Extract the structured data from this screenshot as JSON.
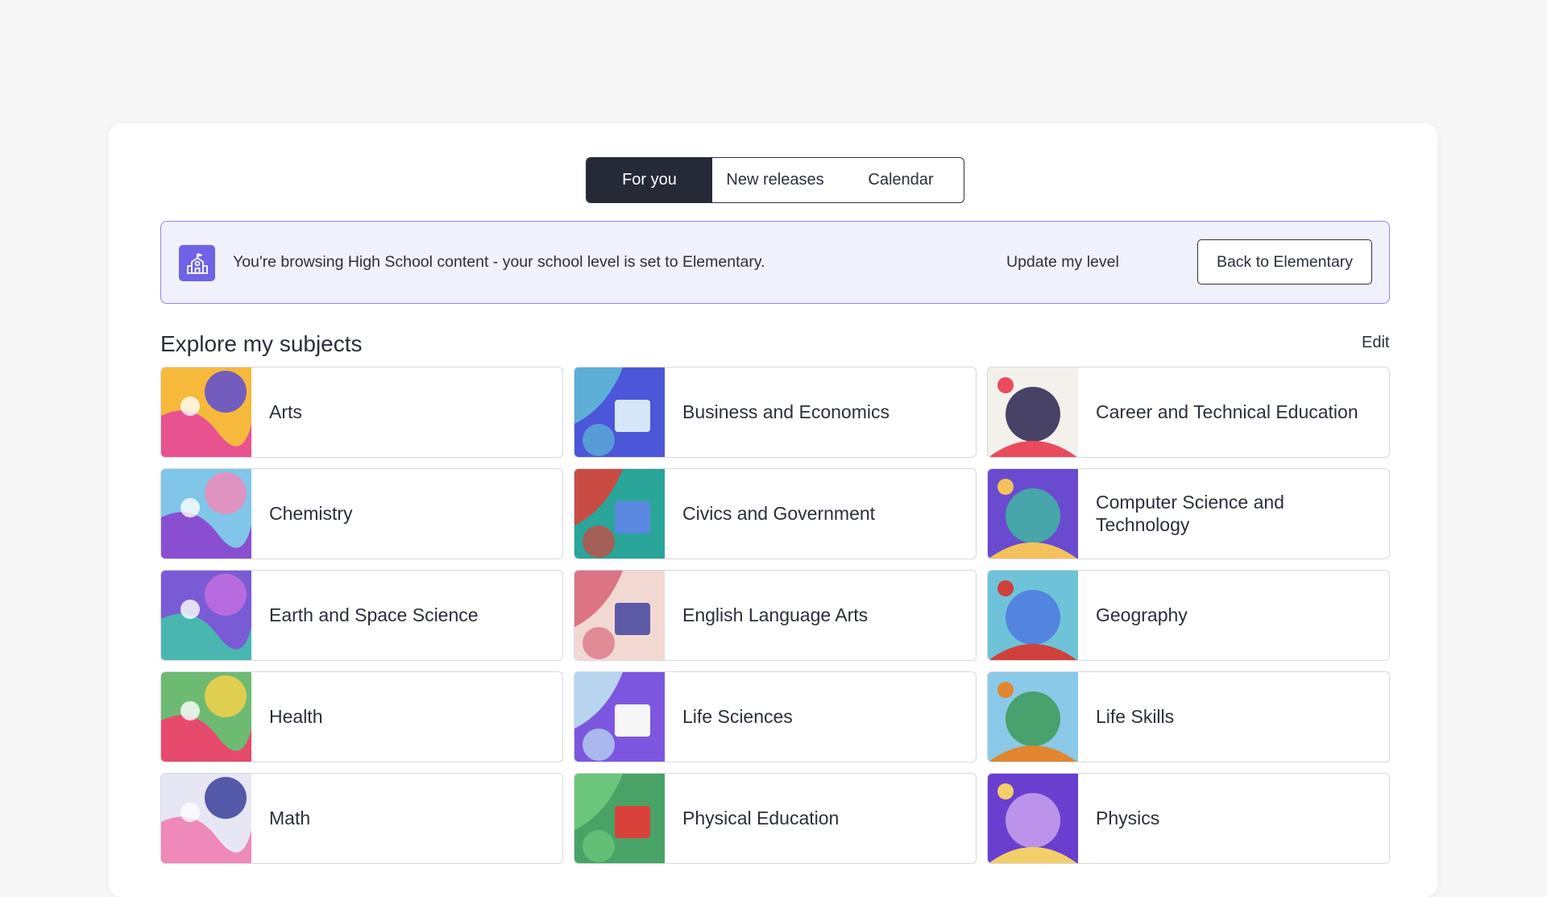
{
  "tabs": [
    {
      "label": "For you",
      "active": true
    },
    {
      "label": "New releases",
      "active": false
    },
    {
      "label": "Calendar",
      "active": false
    }
  ],
  "banner": {
    "icon": "school-building-icon",
    "message": "You're browsing High School content - your school level is set to Elementary.",
    "update_link": "Update my level",
    "back_button": "Back to Elementary"
  },
  "section": {
    "title": "Explore my subjects",
    "edit_label": "Edit"
  },
  "subjects": [
    {
      "label": "Arts",
      "palette": [
        "#f6b93b",
        "#e8528f",
        "#5b4bd6"
      ]
    },
    {
      "label": "Business and Economics",
      "palette": [
        "#4c56d8",
        "#5fb9d8",
        "#d6e6f7"
      ]
    },
    {
      "label": "Career and Technical Education",
      "palette": [
        "#f4f1ec",
        "#2a2350",
        "#e94b5c"
      ]
    },
    {
      "label": "Chemistry",
      "palette": [
        "#7fc6e8",
        "#8a4fd1",
        "#f08ab9"
      ]
    },
    {
      "label": "Civics and Government",
      "palette": [
        "#2aa59a",
        "#d9423b",
        "#5a88e0"
      ]
    },
    {
      "label": "Computer Science and Technology",
      "palette": [
        "#6a4bd0",
        "#3fb6a3",
        "#f3c25a"
      ]
    },
    {
      "label": "Earth and Space Science",
      "palette": [
        "#7a5bd6",
        "#49b7b0",
        "#c26ee0"
      ]
    },
    {
      "label": "English Language Arts",
      "palette": [
        "#f2d8d2",
        "#d9697a",
        "#5d5aa8"
      ]
    },
    {
      "label": "Geography",
      "palette": [
        "#6fc3d9",
        "#4f79e0",
        "#d0403d"
      ]
    },
    {
      "label": "Health",
      "palette": [
        "#6dbb72",
        "#e64a6c",
        "#f4d14a"
      ]
    },
    {
      "label": "Life Sciences",
      "palette": [
        "#7d56e0",
        "#bfe3f2",
        "#f6f6f6"
      ]
    },
    {
      "label": "Life Skills",
      "palette": [
        "#8bc9e8",
        "#3d9a58",
        "#e1862f"
      ]
    },
    {
      "label": "Math",
      "palette": [
        "#e7e6f4",
        "#ef89b9",
        "#3a3f9c"
      ]
    },
    {
      "label": "Physical Education",
      "palette": [
        "#49a367",
        "#6fca7e",
        "#d8423a"
      ]
    },
    {
      "label": "Physics",
      "palette": [
        "#6a3fcf",
        "#c9a2f0",
        "#f3cf6a"
      ]
    }
  ]
}
